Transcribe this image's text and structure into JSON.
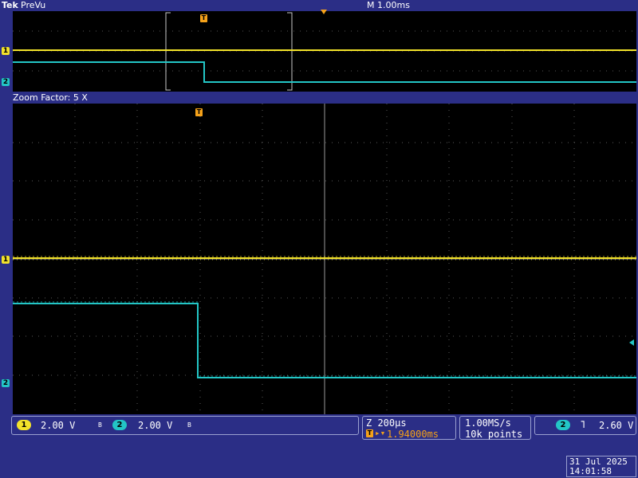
{
  "header": {
    "brand": "Tek",
    "mode": "PreVu",
    "horizontal_scale": "M 1.00ms"
  },
  "zoom": {
    "label": "Zoom Factor: 5 X"
  },
  "channels": {
    "ch1": {
      "id": "1",
      "scale": "2.00 V",
      "color": "#f2e22a"
    },
    "ch2": {
      "id": "2",
      "scale": "2.00 V",
      "color": "#23c6c6"
    }
  },
  "trigger_marker": "T",
  "bandwidth_symbol": "B",
  "timebase": {
    "zoom_scale": "Z 200µs",
    "trigger_position": "1.94000ms"
  },
  "acquisition": {
    "rate": "1.00MS/s",
    "points": "10k points"
  },
  "trigger": {
    "source": "2",
    "slope_symbol": "˥",
    "level": "2.60 V"
  },
  "datetime": {
    "date": "31 Jul  2025",
    "time": "14:01:58"
  }
}
